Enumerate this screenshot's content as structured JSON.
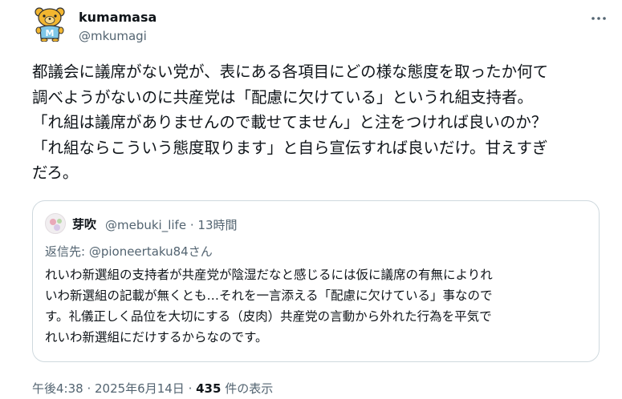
{
  "author": {
    "name": "kumamasa",
    "handle": "@mkumagi",
    "avatar_icon": "bear-mascot-icon"
  },
  "more_icon": "more-options-icon",
  "post": {
    "lines": [
      "都議会に議席がない党が、表にある各項目にどの様な態度を取ったか何て",
      "調べようがないのに共産党は「配慮に欠けている」というれ組支持者。",
      "「れ組は議席がありませんので載せてません」と注をつければ良いのか？",
      "「れ組ならこういう態度取ります」と自ら宣伝すれば良いだけ。甘えすぎ",
      "だろ。"
    ]
  },
  "quote": {
    "name": "芽吹",
    "handle": "@mebuki_life",
    "separator": "·",
    "time": "13時間",
    "reply_prefix": "返信先: ",
    "reply_handle": "@pioneertaku84さん",
    "lines": [
      "れいわ新選組の支持者が共産党が陰湿だなと感じるには仮に議席の有無によりれ",
      "いわ新選組の記載が無くとも…それを一言添える「配慮に欠けている」事なので",
      "す。礼儀正しく品位を大切にする（皮肉）共産党の言動から外れた行為を平気で",
      "れいわ新選組にだけするからなのです。"
    ]
  },
  "footer": {
    "time": "午後4:38",
    "sep1": " · ",
    "date": "2025年6月14日",
    "sep2": " · ",
    "views_count": "435",
    "views_label": " 件の表示"
  }
}
